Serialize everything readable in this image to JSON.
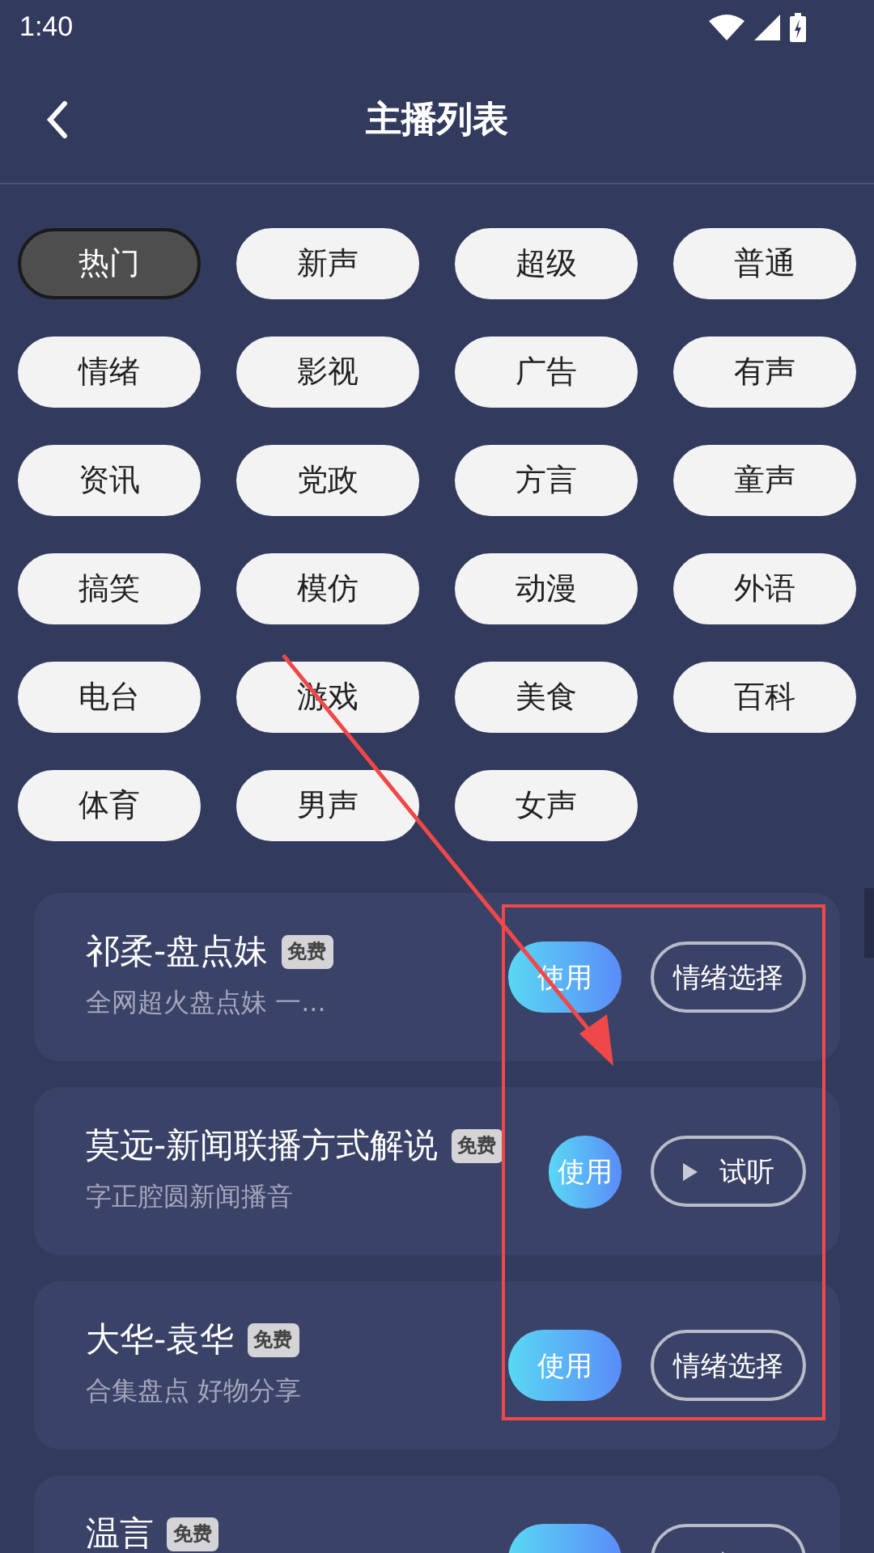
{
  "status_bar": {
    "time": "1:40"
  },
  "header": {
    "title": "主播列表"
  },
  "categories": [
    {
      "label": "热门",
      "selected": true
    },
    {
      "label": "新声",
      "selected": false
    },
    {
      "label": "超级",
      "selected": false
    },
    {
      "label": "普通",
      "selected": false
    },
    {
      "label": "情绪",
      "selected": false
    },
    {
      "label": "影视",
      "selected": false
    },
    {
      "label": "广告",
      "selected": false
    },
    {
      "label": "有声",
      "selected": false
    },
    {
      "label": "资讯",
      "selected": false
    },
    {
      "label": "党政",
      "selected": false
    },
    {
      "label": "方言",
      "selected": false
    },
    {
      "label": "童声",
      "selected": false
    },
    {
      "label": "搞笑",
      "selected": false
    },
    {
      "label": "模仿",
      "selected": false
    },
    {
      "label": "动漫",
      "selected": false
    },
    {
      "label": "外语",
      "selected": false
    },
    {
      "label": "电台",
      "selected": false
    },
    {
      "label": "游戏",
      "selected": false
    },
    {
      "label": "美食",
      "selected": false
    },
    {
      "label": "百科",
      "selected": false
    },
    {
      "label": "体育",
      "selected": false
    },
    {
      "label": "男声",
      "selected": false
    },
    {
      "label": "女声",
      "selected": false
    }
  ],
  "anchors": [
    {
      "name": "祁柔-盘点妹",
      "badge": "免费",
      "description": "全网超火盘点妹 一...",
      "use_button": "使用",
      "action": {
        "kind": "emotion",
        "label": "情绪选择"
      }
    },
    {
      "name": "莫远-新闻联播方式解说",
      "badge": "免费",
      "description": "字正腔圆新闻播音",
      "use_button": "使用",
      "action": {
        "kind": "preview",
        "label": "试听"
      }
    },
    {
      "name": "大华-袁华",
      "badge": "免费",
      "description": "合集盘点 好物分享",
      "use_button": "使用",
      "action": {
        "kind": "emotion",
        "label": "情绪选择"
      }
    },
    {
      "name": "温言",
      "badge": "免费",
      "action": {
        "kind": "preview"
      }
    }
  ]
}
